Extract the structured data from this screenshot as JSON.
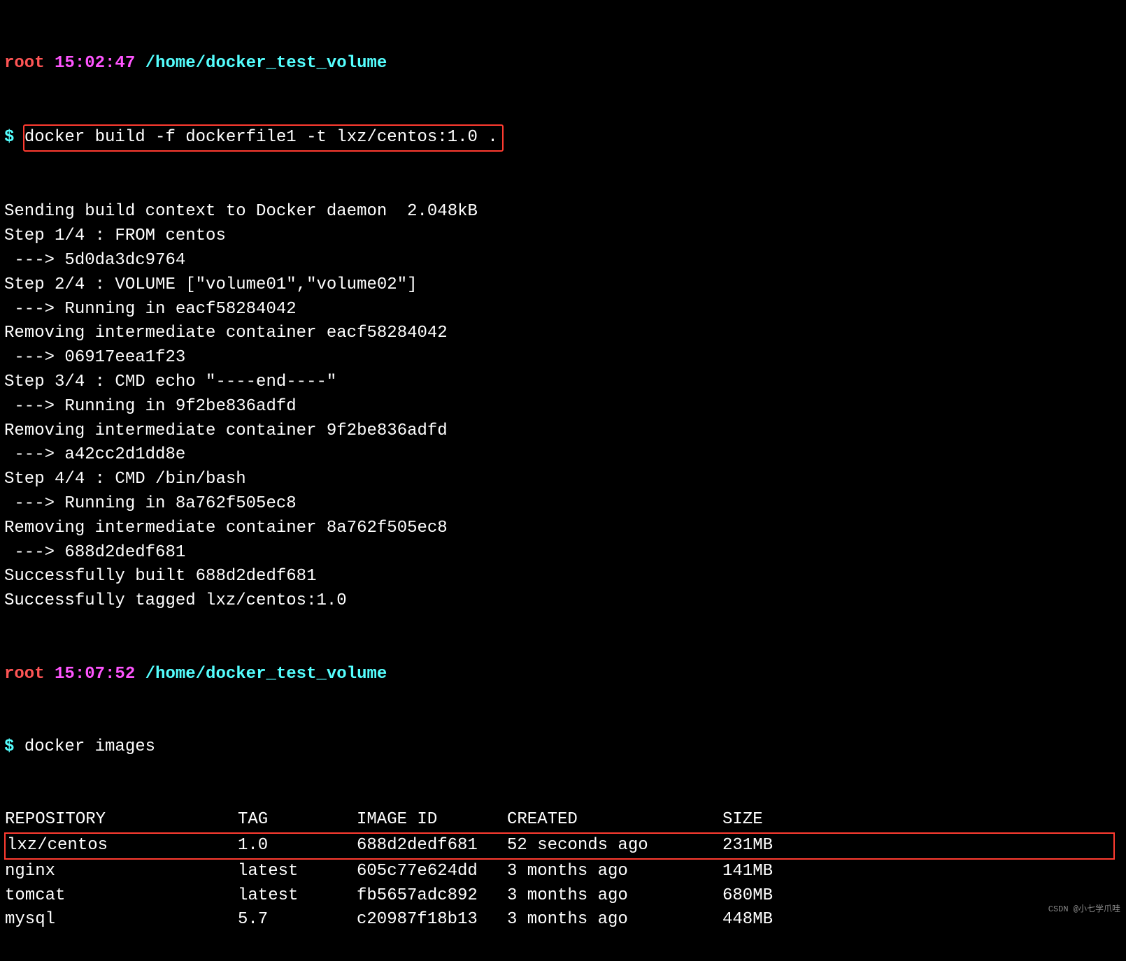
{
  "prompt1": {
    "user": "root",
    "time": "15:02:47",
    "path": "/home/docker_test_volume",
    "dollar": "$",
    "cmd": "docker build -f dockerfile1 -t lxz/centos:1.0 ."
  },
  "build_output": [
    "Sending build context to Docker daemon  2.048kB",
    "Step 1/4 : FROM centos",
    " ---> 5d0da3dc9764",
    "Step 2/4 : VOLUME [\"volume01\",\"volume02\"]",
    " ---> Running in eacf58284042",
    "Removing intermediate container eacf58284042",
    " ---> 06917eea1f23",
    "Step 3/4 : CMD echo \"----end----\"",
    " ---> Running in 9f2be836adfd",
    "Removing intermediate container 9f2be836adfd",
    " ---> a42cc2d1dd8e",
    "Step 4/4 : CMD /bin/bash",
    " ---> Running in 8a762f505ec8",
    "Removing intermediate container 8a762f505ec8",
    " ---> 688d2dedf681",
    "Successfully built 688d2dedf681",
    "Successfully tagged lxz/centos:1.0"
  ],
  "prompt2": {
    "user": "root",
    "time": "15:07:52",
    "path": "/home/docker_test_volume",
    "dollar": "$",
    "cmd": "docker images"
  },
  "images_header": {
    "repo": "REPOSITORY",
    "tag": "TAG",
    "id": "IMAGE ID",
    "created": "CREATED",
    "size": "SIZE"
  },
  "images": [
    {
      "repo": "lxz/centos",
      "tag": "1.0",
      "id": "688d2dedf681",
      "created": "52 seconds ago",
      "size": "231MB",
      "hl": true
    },
    {
      "repo": "nginx",
      "tag": "latest",
      "id": "605c77e624dd",
      "created": "3 months ago",
      "size": "141MB",
      "hl": false
    },
    {
      "repo": "tomcat",
      "tag": "latest",
      "id": "fb5657adc892",
      "created": "3 months ago",
      "size": "680MB",
      "hl": false
    },
    {
      "repo": "mysql",
      "tag": "5.7",
      "id": "c20987f18b13",
      "created": "3 months ago",
      "size": "448MB",
      "hl": false
    }
  ],
  "watermark": "CSDN @小七学爪哇"
}
